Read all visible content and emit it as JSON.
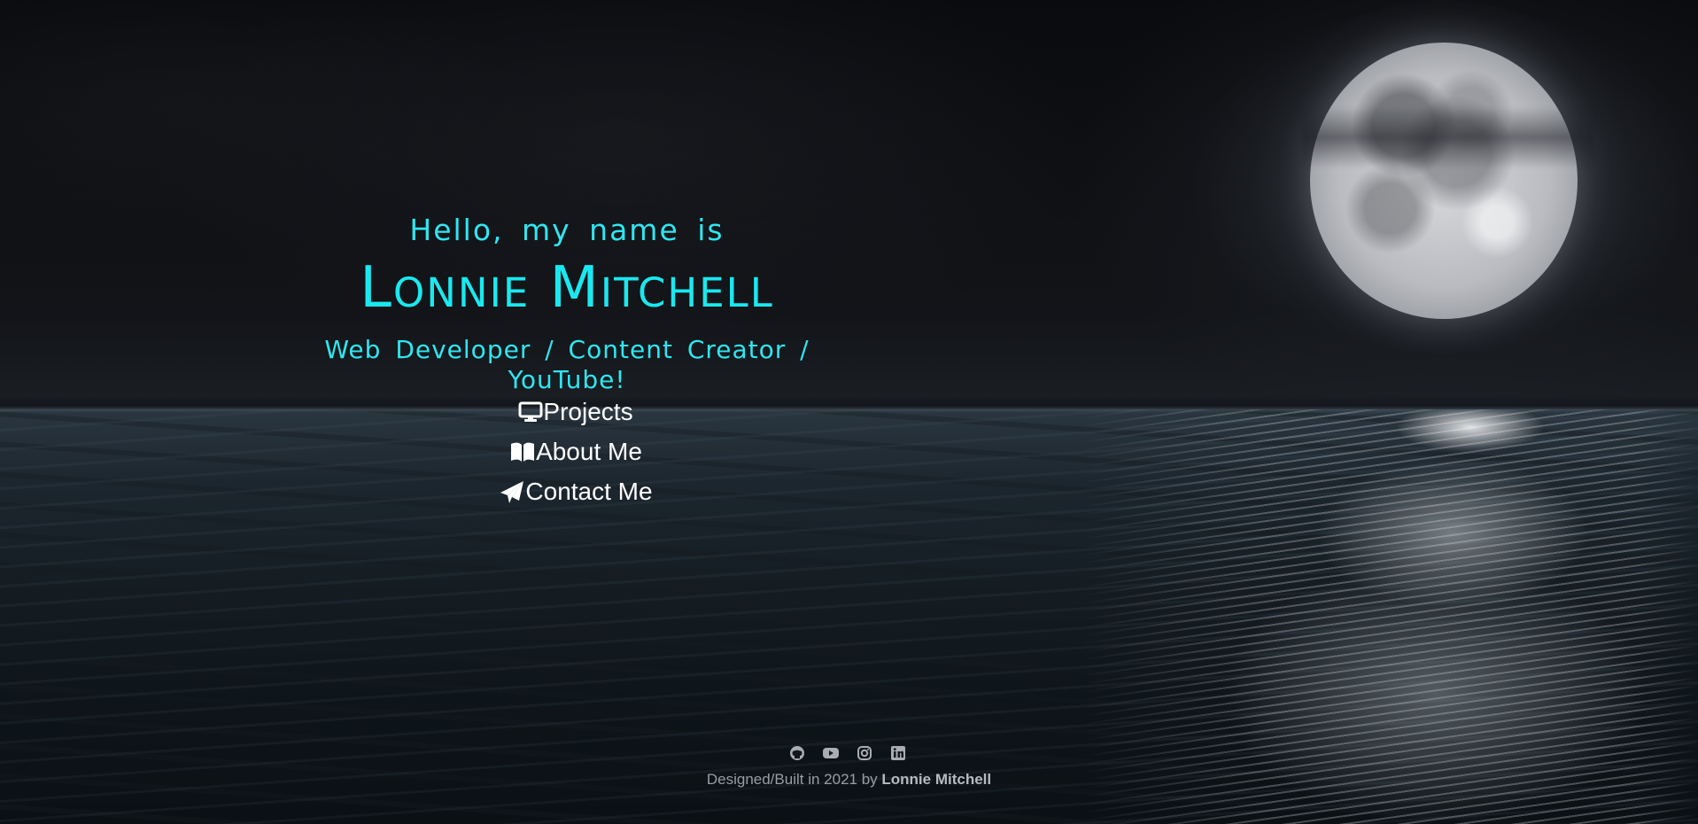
{
  "hero": {
    "greeting": "Hello, my name is",
    "name": "Lonnie Mitchell",
    "tagline": "Web Developer / Content Creator / YouTube!"
  },
  "nav": {
    "items": [
      {
        "label": "Projects",
        "icon": "monitor-icon"
      },
      {
        "label": "About Me",
        "icon": "book-open-icon"
      },
      {
        "label": "Contact Me",
        "icon": "paper-plane-icon"
      }
    ]
  },
  "footer": {
    "social": [
      "github-icon",
      "youtube-icon",
      "instagram-icon",
      "linkedin-icon"
    ],
    "credit_prefix": "Designed/Built in 2021 by",
    "credit_name": "Lonnie Mitchell"
  },
  "colors": {
    "accent": "#1ae8ef",
    "nav_text": "#ffffff",
    "footer_text": "#9a9da3"
  }
}
